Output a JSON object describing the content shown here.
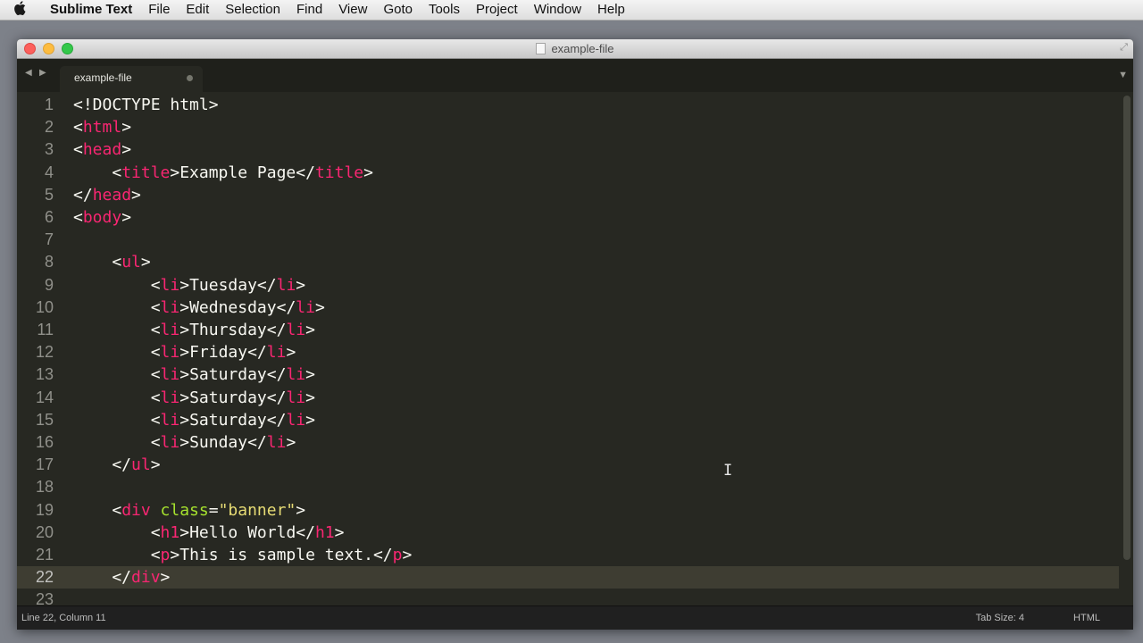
{
  "menubar": {
    "apple": "",
    "app_name": "Sublime Text",
    "items": [
      "File",
      "Edit",
      "Selection",
      "Find",
      "View",
      "Goto",
      "Tools",
      "Project",
      "Window",
      "Help"
    ]
  },
  "window": {
    "title": "example-file",
    "tab_label": "example-file"
  },
  "icons": {
    "close": "close-icon",
    "minimize": "minimize-icon",
    "maximize": "maximize-icon",
    "fullscreen": "fullscreen-icon",
    "tab_nav_left": "triangle-left-icon",
    "tab_nav_right": "triangle-right-icon",
    "tab_dropdown": "triangle-down-icon",
    "tab_modified": "dot-icon",
    "text_cursor": "ibeam-cursor-icon"
  },
  "editor": {
    "current_line": 22,
    "lines": [
      {
        "n": "1",
        "t": [
          [
            "p",
            "<!DOCTYPE html>"
          ]
        ]
      },
      {
        "n": "2",
        "t": [
          [
            "p",
            "<"
          ],
          [
            "tag",
            "html"
          ],
          [
            "p",
            ">"
          ]
        ]
      },
      {
        "n": "3",
        "t": [
          [
            "p",
            "<"
          ],
          [
            "tag",
            "head"
          ],
          [
            "p",
            ">"
          ]
        ]
      },
      {
        "n": "4",
        "t": [
          [
            "p",
            "    <"
          ],
          [
            "tag",
            "title"
          ],
          [
            "p",
            ">Example Page</"
          ],
          [
            "tag",
            "title"
          ],
          [
            "p",
            ">"
          ]
        ]
      },
      {
        "n": "5",
        "t": [
          [
            "p",
            "</"
          ],
          [
            "tag",
            "head"
          ],
          [
            "p",
            ">"
          ]
        ]
      },
      {
        "n": "6",
        "t": [
          [
            "p",
            "<"
          ],
          [
            "tag",
            "body"
          ],
          [
            "p",
            ">"
          ]
        ]
      },
      {
        "n": "7",
        "t": []
      },
      {
        "n": "8",
        "t": [
          [
            "p",
            "    <"
          ],
          [
            "tag",
            "ul"
          ],
          [
            "p",
            ">"
          ]
        ]
      },
      {
        "n": "9",
        "t": [
          [
            "p",
            "        <"
          ],
          [
            "tag",
            "li"
          ],
          [
            "p",
            ">Tuesday</"
          ],
          [
            "tag",
            "li"
          ],
          [
            "p",
            ">"
          ]
        ]
      },
      {
        "n": "10",
        "t": [
          [
            "p",
            "        <"
          ],
          [
            "tag",
            "li"
          ],
          [
            "p",
            ">Wednesday</"
          ],
          [
            "tag",
            "li"
          ],
          [
            "p",
            ">"
          ]
        ]
      },
      {
        "n": "11",
        "t": [
          [
            "p",
            "        <"
          ],
          [
            "tag",
            "li"
          ],
          [
            "p",
            ">Thursday</"
          ],
          [
            "tag",
            "li"
          ],
          [
            "p",
            ">"
          ]
        ]
      },
      {
        "n": "12",
        "t": [
          [
            "p",
            "        <"
          ],
          [
            "tag",
            "li"
          ],
          [
            "p",
            ">Friday</"
          ],
          [
            "tag",
            "li"
          ],
          [
            "p",
            ">"
          ]
        ]
      },
      {
        "n": "13",
        "t": [
          [
            "p",
            "        <"
          ],
          [
            "tag",
            "li"
          ],
          [
            "p",
            ">Saturday</"
          ],
          [
            "tag",
            "li"
          ],
          [
            "p",
            ">"
          ]
        ]
      },
      {
        "n": "14",
        "t": [
          [
            "p",
            "        <"
          ],
          [
            "tag",
            "li"
          ],
          [
            "p",
            ">Saturday</"
          ],
          [
            "tag",
            "li"
          ],
          [
            "p",
            ">"
          ]
        ]
      },
      {
        "n": "15",
        "t": [
          [
            "p",
            "        <"
          ],
          [
            "tag",
            "li"
          ],
          [
            "p",
            ">Saturday</"
          ],
          [
            "tag",
            "li"
          ],
          [
            "p",
            ">"
          ]
        ]
      },
      {
        "n": "16",
        "t": [
          [
            "p",
            "        <"
          ],
          [
            "tag",
            "li"
          ],
          [
            "p",
            ">Sunday</"
          ],
          [
            "tag",
            "li"
          ],
          [
            "p",
            ">"
          ]
        ]
      },
      {
        "n": "17",
        "t": [
          [
            "p",
            "    </"
          ],
          [
            "tag",
            "ul"
          ],
          [
            "p",
            ">"
          ]
        ]
      },
      {
        "n": "18",
        "t": []
      },
      {
        "n": "19",
        "t": [
          [
            "p",
            "    <"
          ],
          [
            "tag",
            "div"
          ],
          [
            "p",
            " "
          ],
          [
            "attr",
            "class"
          ],
          [
            "p",
            "="
          ],
          [
            "str",
            "\"banner\""
          ],
          [
            "p",
            ">"
          ]
        ]
      },
      {
        "n": "20",
        "t": [
          [
            "p",
            "        <"
          ],
          [
            "tag",
            "h1"
          ],
          [
            "p",
            ">Hello World</"
          ],
          [
            "tag",
            "h1"
          ],
          [
            "p",
            ">"
          ]
        ]
      },
      {
        "n": "21",
        "t": [
          [
            "p",
            "        <"
          ],
          [
            "tag",
            "p"
          ],
          [
            "p",
            ">This is sample text.</"
          ],
          [
            "tag",
            "p"
          ],
          [
            "p",
            ">"
          ]
        ]
      },
      {
        "n": "22",
        "t": [
          [
            "p",
            "    </"
          ],
          [
            "tag",
            "div"
          ],
          [
            "p",
            ">"
          ]
        ]
      },
      {
        "n": "23",
        "t": []
      }
    ]
  },
  "statusbar": {
    "position": "Line 22, Column 11",
    "tab_size": "Tab Size: 4",
    "syntax": "HTML"
  }
}
